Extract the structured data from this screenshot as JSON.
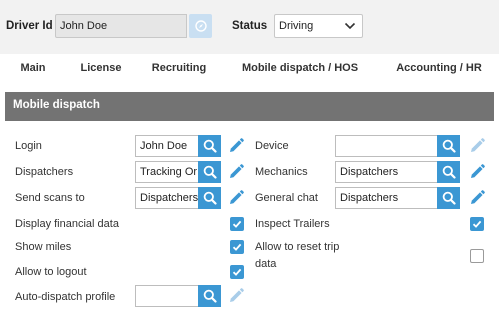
{
  "header": {
    "driver_id_label": "Driver Id",
    "driver_id_value": "John Doe",
    "status_label": "Status",
    "status_value": "Driving"
  },
  "tabs": [
    {
      "label": "Main",
      "active": false
    },
    {
      "label": "License",
      "active": false
    },
    {
      "label": "Recruiting",
      "active": false
    },
    {
      "label": "Mobile dispatch / HOS",
      "active": true
    },
    {
      "label": "Accounting / HR",
      "active": false
    }
  ],
  "section": {
    "title": "Mobile dispatch",
    "left": {
      "login": {
        "label": "Login",
        "value": "John Doe"
      },
      "dispatchers": {
        "label": "Dispatchers",
        "value": "Tracking Or"
      },
      "send_scans_to": {
        "label": "Send scans to",
        "value": "Dispatchers"
      },
      "display_financial_data": {
        "label": "Display financial data",
        "checked": true
      },
      "show_miles": {
        "label": "Show miles",
        "checked": true
      },
      "allow_to_logout": {
        "label": "Allow to logout",
        "checked": true
      },
      "auto_dispatch_profile": {
        "label": "Auto-dispatch profile",
        "value": ""
      }
    },
    "right": {
      "device": {
        "label": "Device",
        "value": ""
      },
      "mechanics": {
        "label": "Mechanics",
        "value": "Dispatchers"
      },
      "general_chat": {
        "label": "General chat",
        "value": "Dispatchers"
      },
      "inspect_trailers": {
        "label": "Inspect Trailers",
        "checked": true
      },
      "allow_reset_trip_data": {
        "label_line1": "Allow to reset trip",
        "label_line2": "data",
        "checked": false
      }
    }
  },
  "colors": {
    "accent": "#3b97d3",
    "section_header": "#737373",
    "header_bg": "#f2f2f2",
    "pen_disabled": "#a9cde9"
  },
  "icons": {
    "search": "search-icon",
    "edit": "pencil-icon",
    "check": "check-icon",
    "dropdown": "chevron-down-icon",
    "compass": "compass-icon"
  }
}
